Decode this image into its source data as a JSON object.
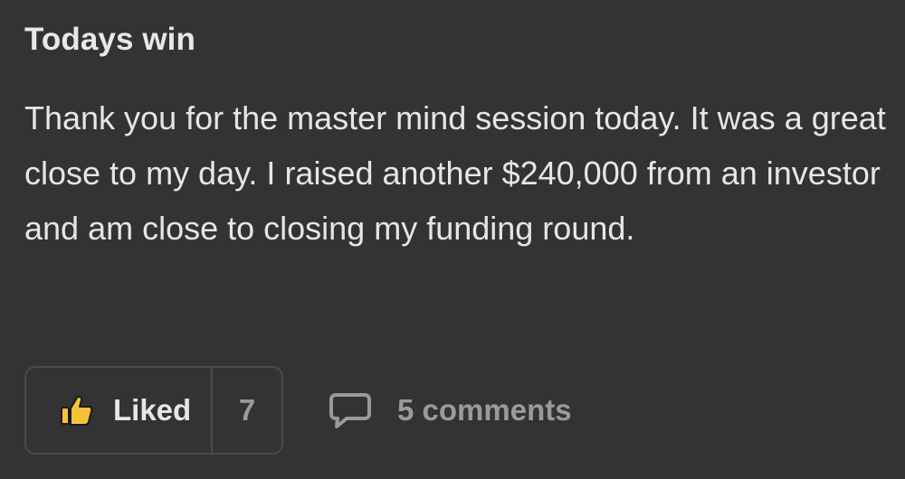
{
  "post": {
    "title": "Todays win",
    "body": "Thank you for the master mind session today. It was a great close to my day. I raised another $240,000 from an investor and am close to closing my funding round."
  },
  "actions": {
    "like_label": "Liked",
    "like_count": "7",
    "comments_label": "5 comments",
    "like_icon": "thumbs-up-icon",
    "comment_icon": "speech-bubble-icon"
  },
  "colors": {
    "background": "#333333",
    "text": "#e6e6e6",
    "muted": "#9a9a9a",
    "border": "#4a4a4a",
    "like_accent": "#f5c33b"
  }
}
